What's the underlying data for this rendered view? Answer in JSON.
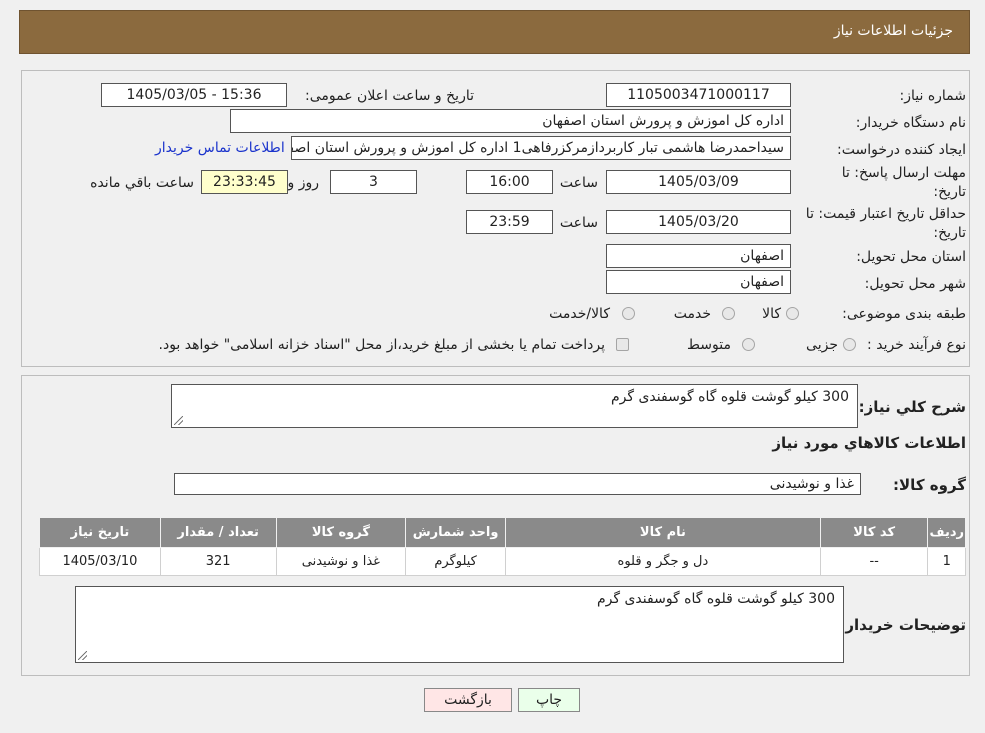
{
  "header": {
    "title": "جزئیات اطلاعات نیاز"
  },
  "fields": {
    "need_number_label": "شماره نیاز:",
    "need_number": "1105003471000117",
    "announce_label": "تاریخ و ساعت اعلان عمومی:",
    "announce_value": "1405/03/05 - 15:36",
    "buyer_org_label": "نام دستگاه خریدار:",
    "buyer_org": "اداره كل اموزش و پرورش استان اصفهان",
    "creator_label": "ایجاد کننده درخواست:",
    "creator": "سیداحمدرضا هاشمی تبار کاربردازمرکزرفاهی1 اداره كل اموزش و پرورش استان اصفهان",
    "contact_link": "اطلاعات تماس خریدار",
    "deadline_label_1": "مهلت ارسال پاسخ: تا",
    "deadline_label_2": "تاریخ:",
    "deadline_date": "1405/03/09",
    "time_label": "ساعت",
    "deadline_time": "16:00",
    "days": "3",
    "days_label": "روز و",
    "remaining": "23:33:45",
    "remaining_label": "ساعت باقي مانده",
    "validity_label_1": "حداقل تاریخ اعتبار قیمت: تا",
    "validity_label_2": "تاریخ:",
    "validity_date": "1405/03/20",
    "validity_time": "23:59",
    "province_label": "استان محل تحویل:",
    "province": "اصفهان",
    "city_label": "شهر محل تحویل:",
    "city": "اصفهان",
    "category_label": "طبقه بندی موضوعی:",
    "category_options": [
      "کالا",
      "خدمت",
      "کالا/خدمت"
    ],
    "process_label": "نوع فرآیند خرید :",
    "process_options": [
      "جزیی",
      "متوسط"
    ],
    "process_note": "پرداخت تمام يا بخشی از مبلغ خريد،از محل \"اسناد خزانه اسلامی\" خواهد بود."
  },
  "summary": {
    "desc_label": "شرح كلي نياز:",
    "desc": "300 کیلو گوشت قلوه گاه گوسفندی گرم",
    "goods_info_title": "اطلاعات كالاهاي مورد نياز",
    "group_label": "گروه كالا:",
    "group": "غذا و نوشیدنی"
  },
  "table": {
    "headers": [
      "رديف",
      "كد كالا",
      "نام كالا",
      "واحد شمارش",
      "گروه كالا",
      "تعداد / مقدار",
      "تاريخ نياز"
    ],
    "rows": [
      [
        "1",
        "--",
        "دل و جگر و قلوه",
        "کیلوگرم",
        "غذا و نوشیدنی",
        "321",
        "1405/03/10"
      ]
    ]
  },
  "buyer_notes": {
    "label": "توضیحات خریدار:",
    "text": "300 کیلو گوشت قلوه گاه گوسفندی گرم"
  },
  "buttons": {
    "print": "چاپ",
    "back": "بازگشت"
  },
  "colors": {
    "header": "#8b6a3e",
    "table_header": "#8a8a8a",
    "link": "#1a33cc",
    "remaining_bg": "#ffffcc",
    "print_bg": "#eaffea",
    "back_bg": "#ffe6e6"
  },
  "watermark_icon": "ariatender-logo"
}
